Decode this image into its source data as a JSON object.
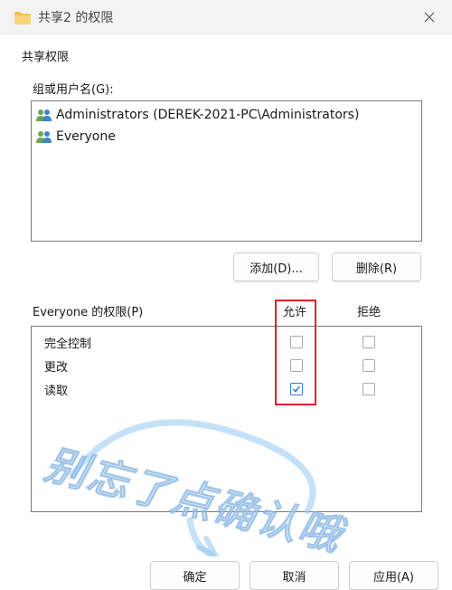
{
  "window": {
    "title": "共享2 的权限",
    "close_icon": "close-icon"
  },
  "section_title": "共享权限",
  "group_label": "组或用户名(G):",
  "users": [
    {
      "name": "Administrators (DEREK-2021-PC\\Administrators)",
      "icon": "users-icon"
    },
    {
      "name": "Everyone",
      "icon": "users-icon"
    }
  ],
  "buttons": {
    "add": "添加(D)...",
    "remove": "删除(R)",
    "ok": "确定",
    "cancel": "取消",
    "apply": "应用(A)"
  },
  "permissions": {
    "header": "Everyone 的权限(P)",
    "allow_label": "允许",
    "deny_label": "拒绝",
    "rows": [
      {
        "name": "完全控制",
        "allow": false,
        "deny": false
      },
      {
        "name": "更改",
        "allow": false,
        "deny": false
      },
      {
        "name": "读取",
        "allow": true,
        "deny": false
      }
    ]
  },
  "watermark": "别忘了点确认哦",
  "colors": {
    "highlight": "#e0202a",
    "checkbox_checked": "#2b7de0",
    "folder": "#f2c14e"
  }
}
